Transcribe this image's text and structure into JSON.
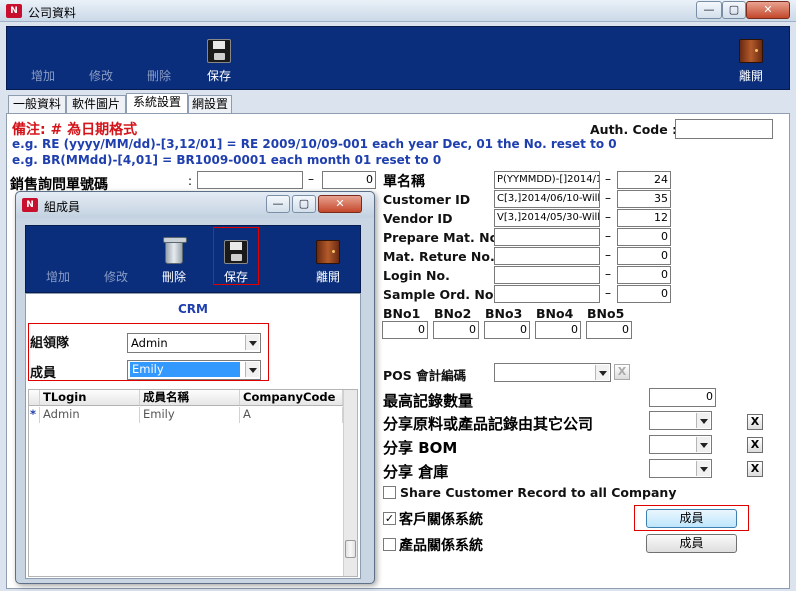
{
  "main_window": {
    "title": "公司資料",
    "caption_buttons": {
      "minimize": "—",
      "maximize": "▢",
      "close": "✕"
    },
    "toolbar": {
      "add": "增加",
      "edit": "修改",
      "delete": "刪除",
      "save": "保存",
      "exit": "離開"
    },
    "tabs": [
      "一般資料",
      "軟件圖片",
      "系統設置",
      "網設置"
    ],
    "active_tab": "系統設置",
    "notes": {
      "title": "備注: # 為日期格式",
      "line1": "e.g. RE (yyyy/MM/dd)-[3,12/01]  = RE 2009/10/09-001   each year Dec, 01 the No. reset to 0",
      "line2": "e.g. BR(MMdd)-[4,01]  = BR1009-0001   each month  01 reset to 0"
    },
    "auth_code": {
      "label": "Auth. Code :",
      "value": ""
    },
    "sales_inquiry": {
      "label": "銷售詢問單號碼",
      "colon": ":",
      "value": "",
      "count": "0"
    },
    "doc_numbers": {
      "header": "單名稱",
      "rows": [
        {
          "label": "Customer ID",
          "format": "C[3,]2014/06/10-Willy",
          "count": "35"
        },
        {
          "label": "Vendor ID",
          "format": "V[3,]2014/05/30-Willy",
          "count": "12"
        },
        {
          "label": "Prepare Mat. No.",
          "format": "",
          "count": "0"
        },
        {
          "label": "Mat. Reture No.",
          "format": "",
          "count": "0"
        },
        {
          "label": "Login No.",
          "format": "",
          "count": "0"
        },
        {
          "label": "Sample Ord. No.",
          "format": "",
          "count": "0"
        }
      ],
      "header_format": "P(YYMMDD)-[]2014/1",
      "header_count": "24"
    },
    "bno": {
      "labels": [
        "BNo1",
        "BNo2",
        "BNo3",
        "BNo4",
        "BNo5"
      ],
      "values": [
        "0",
        "0",
        "0",
        "0",
        "0"
      ]
    },
    "pos_code": {
      "label": "POS 會計編碼",
      "value": "",
      "clear": "X"
    },
    "max_records": {
      "label": "最高記錄數量",
      "value": "0"
    },
    "share_material": {
      "label": "分享原料或產品記錄由其它公司",
      "value": "",
      "clear": "X"
    },
    "share_bom": {
      "label": "分享 BOM",
      "value": "",
      "clear": "X"
    },
    "share_warehouse": {
      "label": "分享 倉庫",
      "value": "",
      "clear": "X"
    },
    "share_customer": {
      "label": "Share Customer Record to all Company",
      "checked": false
    },
    "crm_system": {
      "label": "客戶關係系統",
      "checked": true,
      "button": "成員"
    },
    "prm_system": {
      "label": "產品關係系統",
      "checked": false,
      "button": "成員"
    }
  },
  "dialog": {
    "title": "組成員",
    "caption_buttons": {
      "minimize": "—",
      "maximize": "▢",
      "close": "✕"
    },
    "toolbar": {
      "add": "增加",
      "edit": "修改",
      "delete": "刪除",
      "save": "保存",
      "exit": "離開"
    },
    "section": "CRM",
    "team_leader": {
      "label": "組領隊",
      "value": "Admin"
    },
    "member": {
      "label": "成員",
      "value": "Emily"
    },
    "grid": {
      "columns": [
        "TLogin",
        "成員名稱",
        "CompanyCode"
      ],
      "rows": [
        {
          "marker": "*",
          "cells": [
            "Admin",
            "Emily",
            "A"
          ]
        }
      ]
    }
  },
  "colors": {
    "toolbar_bg": "#0a2e7c",
    "note_red": "#d4141a",
    "note_blue": "#1f3fae",
    "highlight_red": "#e00000",
    "selection": "#3399ff"
  }
}
